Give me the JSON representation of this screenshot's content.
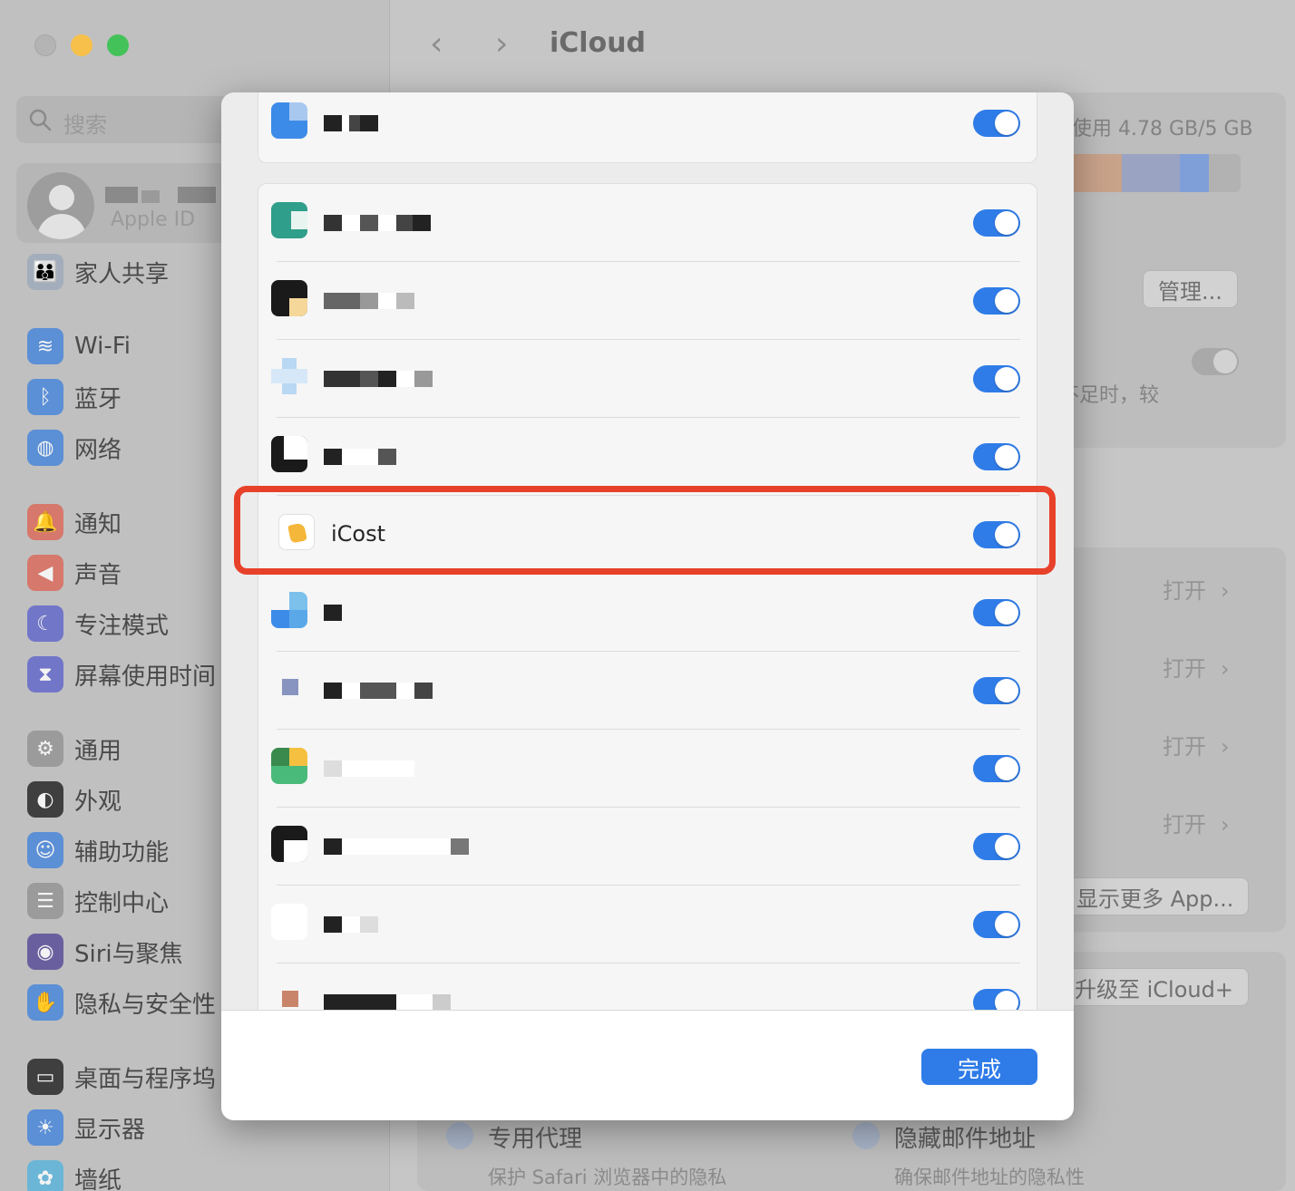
{
  "window": {
    "title": "iCloud",
    "traffic_lights": {
      "close": "#b4b4b4",
      "minimize": "#f6c04a",
      "maximize": "#43c25a"
    }
  },
  "sidebar": {
    "search_placeholder": "搜索",
    "account_subtitle": "Apple ID",
    "items": [
      {
        "label": "家人共享",
        "icon": "family-icon",
        "color": "#a3adbb"
      },
      {
        "label": "Wi-Fi",
        "icon": "wifi-icon",
        "color": "#5b8fd6"
      },
      {
        "label": "蓝牙",
        "icon": "bluetooth-icon",
        "color": "#5b8fd6"
      },
      {
        "label": "网络",
        "icon": "globe-icon",
        "color": "#5b8fd6"
      },
      {
        "label": "通知",
        "icon": "bell-icon",
        "color": "#d6786c"
      },
      {
        "label": "声音",
        "icon": "speaker-icon",
        "color": "#d6786c"
      },
      {
        "label": "专注模式",
        "icon": "moon-icon",
        "color": "#7276c8"
      },
      {
        "label": "屏幕使用时间",
        "icon": "hourglass-icon",
        "color": "#7276c8"
      },
      {
        "label": "通用",
        "icon": "gear-icon",
        "color": "#9b9b9b"
      },
      {
        "label": "外观",
        "icon": "appearance-icon",
        "color": "#3f3f3f"
      },
      {
        "label": "辅助功能",
        "icon": "accessibility-icon",
        "color": "#5b8fd6"
      },
      {
        "label": "控制中心",
        "icon": "toggles-icon",
        "color": "#9b9b9b"
      },
      {
        "label": "Siri与聚焦",
        "icon": "siri-icon",
        "color": "#6a5f9e"
      },
      {
        "label": "隐私与安全性",
        "icon": "hand-icon",
        "color": "#5b8fd6"
      },
      {
        "label": "桌面与程序坞",
        "icon": "dock-icon",
        "color": "#3f3f3f"
      },
      {
        "label": "显示器",
        "icon": "sun-icon",
        "color": "#5b8fd6"
      },
      {
        "label": "墙纸",
        "icon": "flower-icon",
        "color": "#6bb6d6"
      }
    ]
  },
  "content": {
    "storage_text": "使用 4.78 GB/5 GB",
    "storage_segments": [
      {
        "color": "#c9a28a",
        "fraction": 0.32
      },
      {
        "color": "#9aa4c2",
        "fraction": 0.33
      },
      {
        "color": "#7f9fd8",
        "fraction": 0.17
      }
    ],
    "manage_button": "管理...",
    "note_text": "不足时，较",
    "open_label": "打开",
    "open_chevron": "›",
    "show_more_button": "显示更多 App...",
    "upgrade_button": "升级至 iCloud+",
    "features": [
      {
        "title": "专用代理",
        "desc": "保护 Safari 浏览器中的隐私"
      },
      {
        "title": "隐藏邮件地址",
        "desc": "确保邮件地址的隐私性"
      }
    ]
  },
  "sheet": {
    "highlighted_app": "iCost",
    "app_toggles": [
      {
        "name": "",
        "on": true
      },
      {
        "name": "",
        "on": true
      },
      {
        "name": "",
        "on": true
      },
      {
        "name": "",
        "on": true
      },
      {
        "name": "",
        "on": true
      },
      {
        "name": "iCost",
        "on": true
      },
      {
        "name": "",
        "on": true
      },
      {
        "name": "",
        "on": true
      },
      {
        "name": "",
        "on": true
      },
      {
        "name": "",
        "on": true
      },
      {
        "name": "",
        "on": true
      },
      {
        "name": "",
        "on": true
      }
    ],
    "done_button": "完成",
    "accent_color": "#2f7ce8",
    "highlight_color": "#e8412a"
  },
  "nav": {
    "back": "‹",
    "forward": "›"
  }
}
